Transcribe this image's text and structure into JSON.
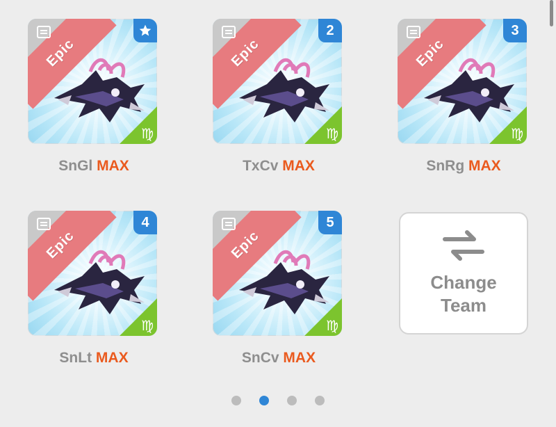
{
  "monsters": [
    {
      "name": "SnGl",
      "level": "MAX",
      "rarity": "Epic",
      "slot": "",
      "slot_icon": "star-icon"
    },
    {
      "name": "TxCv",
      "level": "MAX",
      "rarity": "Epic",
      "slot": "2"
    },
    {
      "name": "SnRg",
      "level": "MAX",
      "rarity": "Epic",
      "slot": "3"
    },
    {
      "name": "SnLt",
      "level": "MAX",
      "rarity": "Epic",
      "slot": "4"
    },
    {
      "name": "SnCv",
      "level": "MAX",
      "rarity": "Epic",
      "slot": "5"
    }
  ],
  "zodiac_glyph": "♍",
  "change_team": {
    "line1": "Change",
    "line2": "Team"
  },
  "pagination": {
    "pages": 4,
    "current": 2
  },
  "colors": {
    "rarity_ribbon": "#e77b7f",
    "max_text": "#ea5a1e",
    "slot_badge": "#2f86d6",
    "zodiac": "#7cc42e"
  }
}
